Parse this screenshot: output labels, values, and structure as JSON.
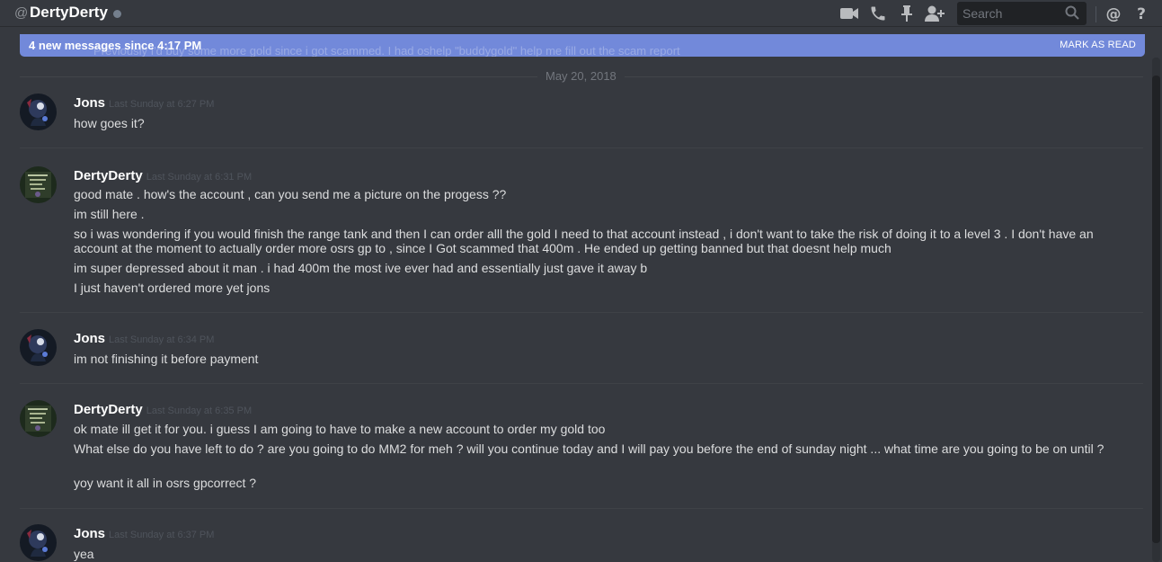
{
  "header": {
    "at_symbol": "@",
    "dm_name": "DertyDerty",
    "search_placeholder": "Search",
    "icons": [
      "video-call-icon",
      "voice-call-icon",
      "pin-icon",
      "add-friend-icon",
      "mentions-icon",
      "help-icon"
    ]
  },
  "new_messages_bar": {
    "text": "4 new messages since 4:17 PM",
    "mark_as_read": "MARK AS READ",
    "ghost_text": "Previously I'd buy some more gold since i got scammed. I had oshelp \"buddygold\" help me fill out the scam report"
  },
  "date_separator": "May 20, 2018",
  "messages": [
    {
      "author": "Jons",
      "timestamp": "Last Sunday at 6:27 PM",
      "lines": [
        "how goes it?"
      ]
    },
    {
      "author": "DertyDerty",
      "timestamp": "Last Sunday at 6:31 PM",
      "lines": [
        "good mate . how's the account , can you send me a picture on the progess ??",
        "im still here .",
        "so i was wondering if you would finish the range tank and then I can order alll the gold I need to that account instead , i don't want to take the risk of doing it to a level 3 . I don't have an account at the moment to actually order more osrs gp to , since I Got scammed that 400m . He ended up getting banned but that doesnt help much",
        "im super depressed about it man . i had 400m the most ive ever had and essentially just gave it away b",
        "I just haven't ordered more yet jons"
      ]
    },
    {
      "author": "Jons",
      "timestamp": "Last Sunday at 6:34 PM",
      "lines": [
        "im not finishing it before payment"
      ]
    },
    {
      "author": "DertyDerty",
      "timestamp": "Last Sunday at 6:35 PM",
      "lines": [
        "ok mate ill get it for you. i guess I am going to have to make a new account to order my gold too",
        "What else do you have left to do ? are you going to do MM2 for meh ? will you continue today and I will pay you before the end of sunday night ... what time are you going to be on until ?",
        "yoy want it all in osrs gpcorrect ?"
      ]
    },
    {
      "author": "Jons",
      "timestamp": "Last Sunday at 6:37 PM",
      "lines": [
        "yea"
      ]
    }
  ],
  "colors": {
    "background": "#36393f",
    "accent_bar": "#7289da",
    "author": "#ffffff",
    "timestamp": "#4f545c",
    "text": "#dcddde"
  }
}
